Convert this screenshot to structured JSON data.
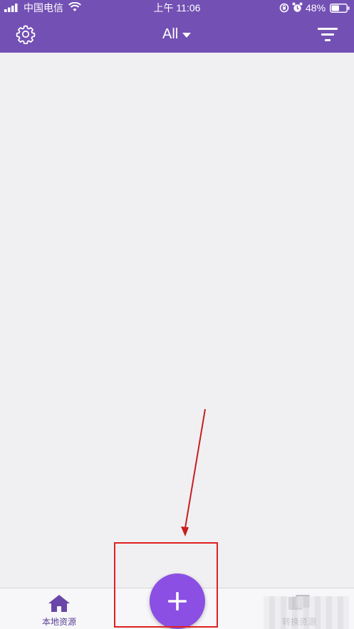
{
  "status_bar": {
    "carrier": "中国电信",
    "time": "上午 11:06",
    "battery": "48%",
    "icons": [
      "signal-icon",
      "wifi-icon",
      "rotation-lock-icon",
      "alarm-icon",
      "battery-icon"
    ]
  },
  "header": {
    "settings_icon": "gear-icon",
    "filter_label": "All",
    "filter_icon": "caret-down-icon",
    "sort_icon": "sort-icon"
  },
  "bottom_nav": {
    "home_label": "本地资源",
    "home_icon": "home-icon",
    "convert_label": "转换资源",
    "convert_icon": "convert-icon"
  },
  "fab": {
    "icon": "plus-icon"
  },
  "colors": {
    "primary": "#7350b4",
    "fab": "#8b4fe3",
    "background": "#f0f0f2",
    "annotation": "#e02020"
  }
}
